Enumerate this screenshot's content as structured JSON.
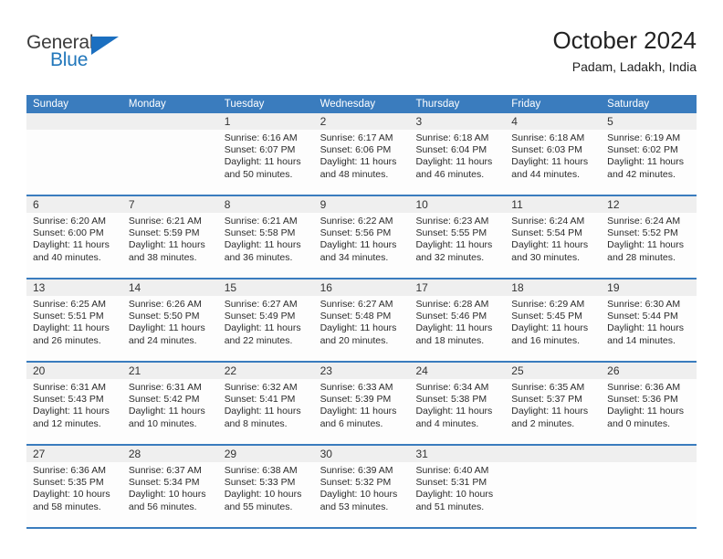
{
  "brand": {
    "line1": "General",
    "line2": "Blue",
    "triangle_color": "#1b6fc0"
  },
  "header": {
    "title": "October 2024",
    "location": "Padam, Ladakh, India"
  },
  "theme": {
    "header_blue": "#3a7cbe",
    "datebar_gray": "#efefef",
    "text": "#2b2b2b"
  },
  "weekdays": [
    "Sunday",
    "Monday",
    "Tuesday",
    "Wednesday",
    "Thursday",
    "Friday",
    "Saturday"
  ],
  "weeks": [
    {
      "days": [
        {
          "num": "",
          "lines": []
        },
        {
          "num": "",
          "lines": []
        },
        {
          "num": "1",
          "lines": [
            "Sunrise: 6:16 AM",
            "Sunset: 6:07 PM",
            "Daylight: 11 hours",
            "and 50 minutes."
          ]
        },
        {
          "num": "2",
          "lines": [
            "Sunrise: 6:17 AM",
            "Sunset: 6:06 PM",
            "Daylight: 11 hours",
            "and 48 minutes."
          ]
        },
        {
          "num": "3",
          "lines": [
            "Sunrise: 6:18 AM",
            "Sunset: 6:04 PM",
            "Daylight: 11 hours",
            "and 46 minutes."
          ]
        },
        {
          "num": "4",
          "lines": [
            "Sunrise: 6:18 AM",
            "Sunset: 6:03 PM",
            "Daylight: 11 hours",
            "and 44 minutes."
          ]
        },
        {
          "num": "5",
          "lines": [
            "Sunrise: 6:19 AM",
            "Sunset: 6:02 PM",
            "Daylight: 11 hours",
            "and 42 minutes."
          ]
        }
      ]
    },
    {
      "days": [
        {
          "num": "6",
          "lines": [
            "Sunrise: 6:20 AM",
            "Sunset: 6:00 PM",
            "Daylight: 11 hours",
            "and 40 minutes."
          ]
        },
        {
          "num": "7",
          "lines": [
            "Sunrise: 6:21 AM",
            "Sunset: 5:59 PM",
            "Daylight: 11 hours",
            "and 38 minutes."
          ]
        },
        {
          "num": "8",
          "lines": [
            "Sunrise: 6:21 AM",
            "Sunset: 5:58 PM",
            "Daylight: 11 hours",
            "and 36 minutes."
          ]
        },
        {
          "num": "9",
          "lines": [
            "Sunrise: 6:22 AM",
            "Sunset: 5:56 PM",
            "Daylight: 11 hours",
            "and 34 minutes."
          ]
        },
        {
          "num": "10",
          "lines": [
            "Sunrise: 6:23 AM",
            "Sunset: 5:55 PM",
            "Daylight: 11 hours",
            "and 32 minutes."
          ]
        },
        {
          "num": "11",
          "lines": [
            "Sunrise: 6:24 AM",
            "Sunset: 5:54 PM",
            "Daylight: 11 hours",
            "and 30 minutes."
          ]
        },
        {
          "num": "12",
          "lines": [
            "Sunrise: 6:24 AM",
            "Sunset: 5:52 PM",
            "Daylight: 11 hours",
            "and 28 minutes."
          ]
        }
      ]
    },
    {
      "days": [
        {
          "num": "13",
          "lines": [
            "Sunrise: 6:25 AM",
            "Sunset: 5:51 PM",
            "Daylight: 11 hours",
            "and 26 minutes."
          ]
        },
        {
          "num": "14",
          "lines": [
            "Sunrise: 6:26 AM",
            "Sunset: 5:50 PM",
            "Daylight: 11 hours",
            "and 24 minutes."
          ]
        },
        {
          "num": "15",
          "lines": [
            "Sunrise: 6:27 AM",
            "Sunset: 5:49 PM",
            "Daylight: 11 hours",
            "and 22 minutes."
          ]
        },
        {
          "num": "16",
          "lines": [
            "Sunrise: 6:27 AM",
            "Sunset: 5:48 PM",
            "Daylight: 11 hours",
            "and 20 minutes."
          ]
        },
        {
          "num": "17",
          "lines": [
            "Sunrise: 6:28 AM",
            "Sunset: 5:46 PM",
            "Daylight: 11 hours",
            "and 18 minutes."
          ]
        },
        {
          "num": "18",
          "lines": [
            "Sunrise: 6:29 AM",
            "Sunset: 5:45 PM",
            "Daylight: 11 hours",
            "and 16 minutes."
          ]
        },
        {
          "num": "19",
          "lines": [
            "Sunrise: 6:30 AM",
            "Sunset: 5:44 PM",
            "Daylight: 11 hours",
            "and 14 minutes."
          ]
        }
      ]
    },
    {
      "days": [
        {
          "num": "20",
          "lines": [
            "Sunrise: 6:31 AM",
            "Sunset: 5:43 PM",
            "Daylight: 11 hours",
            "and 12 minutes."
          ]
        },
        {
          "num": "21",
          "lines": [
            "Sunrise: 6:31 AM",
            "Sunset: 5:42 PM",
            "Daylight: 11 hours",
            "and 10 minutes."
          ]
        },
        {
          "num": "22",
          "lines": [
            "Sunrise: 6:32 AM",
            "Sunset: 5:41 PM",
            "Daylight: 11 hours",
            "and 8 minutes."
          ]
        },
        {
          "num": "23",
          "lines": [
            "Sunrise: 6:33 AM",
            "Sunset: 5:39 PM",
            "Daylight: 11 hours",
            "and 6 minutes."
          ]
        },
        {
          "num": "24",
          "lines": [
            "Sunrise: 6:34 AM",
            "Sunset: 5:38 PM",
            "Daylight: 11 hours",
            "and 4 minutes."
          ]
        },
        {
          "num": "25",
          "lines": [
            "Sunrise: 6:35 AM",
            "Sunset: 5:37 PM",
            "Daylight: 11 hours",
            "and 2 minutes."
          ]
        },
        {
          "num": "26",
          "lines": [
            "Sunrise: 6:36 AM",
            "Sunset: 5:36 PM",
            "Daylight: 11 hours",
            "and 0 minutes."
          ]
        }
      ]
    },
    {
      "days": [
        {
          "num": "27",
          "lines": [
            "Sunrise: 6:36 AM",
            "Sunset: 5:35 PM",
            "Daylight: 10 hours",
            "and 58 minutes."
          ]
        },
        {
          "num": "28",
          "lines": [
            "Sunrise: 6:37 AM",
            "Sunset: 5:34 PM",
            "Daylight: 10 hours",
            "and 56 minutes."
          ]
        },
        {
          "num": "29",
          "lines": [
            "Sunrise: 6:38 AM",
            "Sunset: 5:33 PM",
            "Daylight: 10 hours",
            "and 55 minutes."
          ]
        },
        {
          "num": "30",
          "lines": [
            "Sunrise: 6:39 AM",
            "Sunset: 5:32 PM",
            "Daylight: 10 hours",
            "and 53 minutes."
          ]
        },
        {
          "num": "31",
          "lines": [
            "Sunrise: 6:40 AM",
            "Sunset: 5:31 PM",
            "Daylight: 10 hours",
            "and 51 minutes."
          ]
        },
        {
          "num": "",
          "lines": []
        },
        {
          "num": "",
          "lines": []
        }
      ]
    }
  ]
}
